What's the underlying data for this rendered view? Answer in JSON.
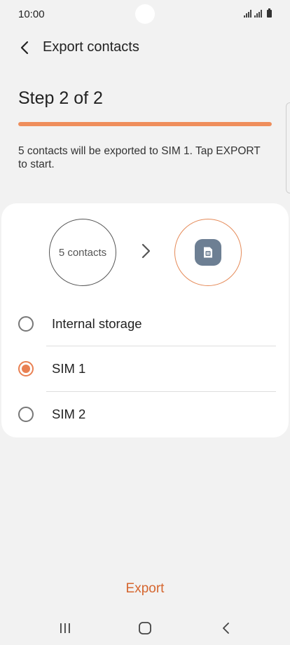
{
  "status_bar": {
    "time": "10:00"
  },
  "header": {
    "title": "Export contacts",
    "back_icon": "chevron-left-icon"
  },
  "step": {
    "title": "Step 2 of 2",
    "progress": 1.0
  },
  "description": "5 contacts will be exported to SIM 1. Tap EXPORT to start.",
  "transfer": {
    "source_label": "5 contacts",
    "target_icon": "sim-card-icon"
  },
  "options": [
    {
      "label": "Internal storage",
      "selected": false
    },
    {
      "label": "SIM 1",
      "selected": true
    },
    {
      "label": "SIM 2",
      "selected": false
    }
  ],
  "export_label": "Export",
  "colors": {
    "accent": "#e98052",
    "export_text": "#d5662f",
    "sim_tile": "#6d7f93",
    "background": "#f2f2f2"
  },
  "nav": {
    "recents_icon": "recents-icon",
    "home_icon": "home-icon",
    "back_icon": "back-icon"
  }
}
